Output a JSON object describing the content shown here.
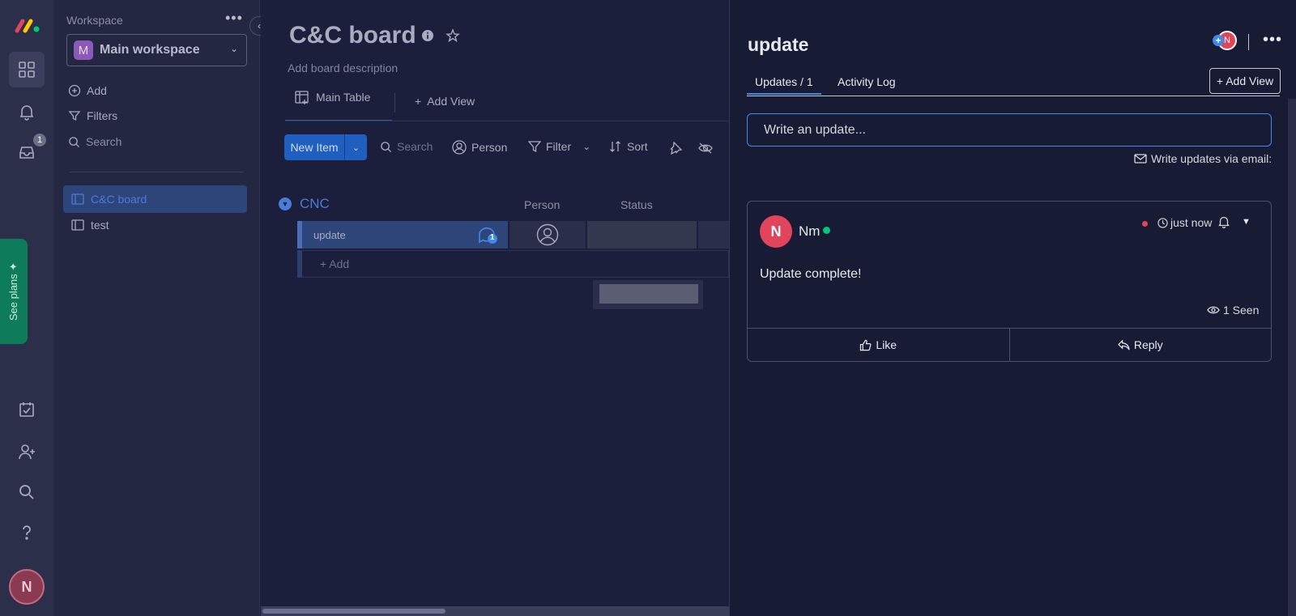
{
  "workspace": {
    "label": "Workspace",
    "more": "•••",
    "selected": {
      "initial": "M",
      "name": "Main workspace"
    },
    "actions": [
      {
        "label": "Add",
        "icon": "plus-circle-icon"
      },
      {
        "label": "Filters",
        "icon": "filter-icon"
      },
      {
        "label": "Search",
        "icon": "search-icon"
      }
    ],
    "boards": [
      {
        "label": "C&C board",
        "selected": true
      },
      {
        "label": "test",
        "selected": false
      }
    ]
  },
  "rail": {
    "inbox_badge": "1",
    "see_plans": "See plans",
    "avatar_initial": "N"
  },
  "board": {
    "title": "C&C board",
    "description": "Add board description",
    "tabs": {
      "main": "Main Table",
      "add_view": "Add View"
    },
    "toolbar": {
      "new_item": "New Item",
      "search": "Search",
      "person": "Person",
      "filter": "Filter",
      "sort": "Sort"
    },
    "group": {
      "name": "CNC",
      "columns": {
        "person": "Person",
        "status": "Status"
      },
      "rows": [
        {
          "name": "update",
          "updates_count": "1"
        }
      ],
      "add_row": "+ Add"
    }
  },
  "panel": {
    "title": "update",
    "subscriber_initial": "N",
    "tabs": {
      "updates": "Updates / 1",
      "activity": "Activity Log"
    },
    "add_view": "+ Add View",
    "write_placeholder": "Write an update...",
    "write_via_email": "Write updates via email:",
    "post": {
      "author_initial": "N",
      "author": "Nm",
      "time": "just now",
      "body": "Update complete!",
      "seen": "1 Seen",
      "like": "Like",
      "reply": "Reply"
    }
  },
  "colors": {
    "accent": "#3f8ae6",
    "brand_pink": "#e2445c",
    "online_green": "#00c875",
    "plans_green": "#0e7c5a"
  }
}
